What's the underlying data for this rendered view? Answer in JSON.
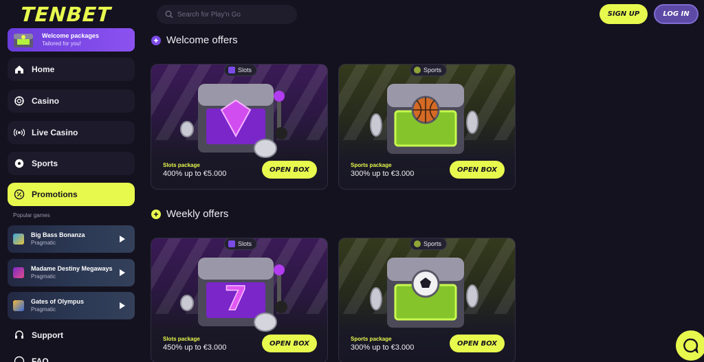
{
  "brand": {
    "logo_text": "TENBET",
    "accent": "#e8f94e",
    "purple": "#7b4be6"
  },
  "welcome_card": {
    "title": "Welcome packages",
    "subtitle": "Tailored for you!"
  },
  "nav": [
    {
      "label": "Home",
      "icon": "home-icon",
      "active": false
    },
    {
      "label": "Casino",
      "icon": "casino-chip-icon",
      "active": false
    },
    {
      "label": "Live Casino",
      "icon": "live-broadcast-icon",
      "active": false
    },
    {
      "label": "Sports",
      "icon": "soccer-ball-icon",
      "active": false
    },
    {
      "label": "Promotions",
      "icon": "percent-badge-icon",
      "active": true
    }
  ],
  "popular": {
    "title": "Popular games",
    "games": [
      {
        "name": "Big Bass Bonanza",
        "provider": "Pragmatic"
      },
      {
        "name": "Madame Destiny Megaways",
        "provider": "Pragmatic"
      },
      {
        "name": "Gates of Olympus",
        "provider": "Pragmatic"
      }
    ]
  },
  "bottom_nav": [
    {
      "label": "Support",
      "icon": "headset-icon"
    },
    {
      "label": "FAQ",
      "icon": "question-icon"
    }
  ],
  "header": {
    "search_placeholder": "Search for Play'n Go",
    "signup_label": "SIGN UP",
    "login_label": "LOG IN"
  },
  "sections": [
    {
      "title": "Welcome offers",
      "offers": [
        {
          "tag": "Slots",
          "kind": "slots",
          "package": "Slots package",
          "bonus": "400% up to €5.000",
          "button": "OPEN BOX",
          "prize_icon": "diamond-icon"
        },
        {
          "tag": "Sports",
          "kind": "sports",
          "package": "Sports package",
          "bonus": "300% up to €3.000",
          "button": "OPEN BOX",
          "prize_icon": "basketball-icon"
        }
      ]
    },
    {
      "title": "Weekly offers",
      "offers": [
        {
          "tag": "Slots",
          "kind": "slots",
          "package": "Slots package",
          "bonus": "450% up to €3.000",
          "button": "OPEN BOX",
          "prize_icon": "lucky-seven-icon"
        },
        {
          "tag": "Sports",
          "kind": "sports",
          "package": "Sports package",
          "bonus": "300% up to €3.000",
          "button": "OPEN BOX",
          "prize_icon": "soccer-ball-icon"
        }
      ]
    }
  ]
}
